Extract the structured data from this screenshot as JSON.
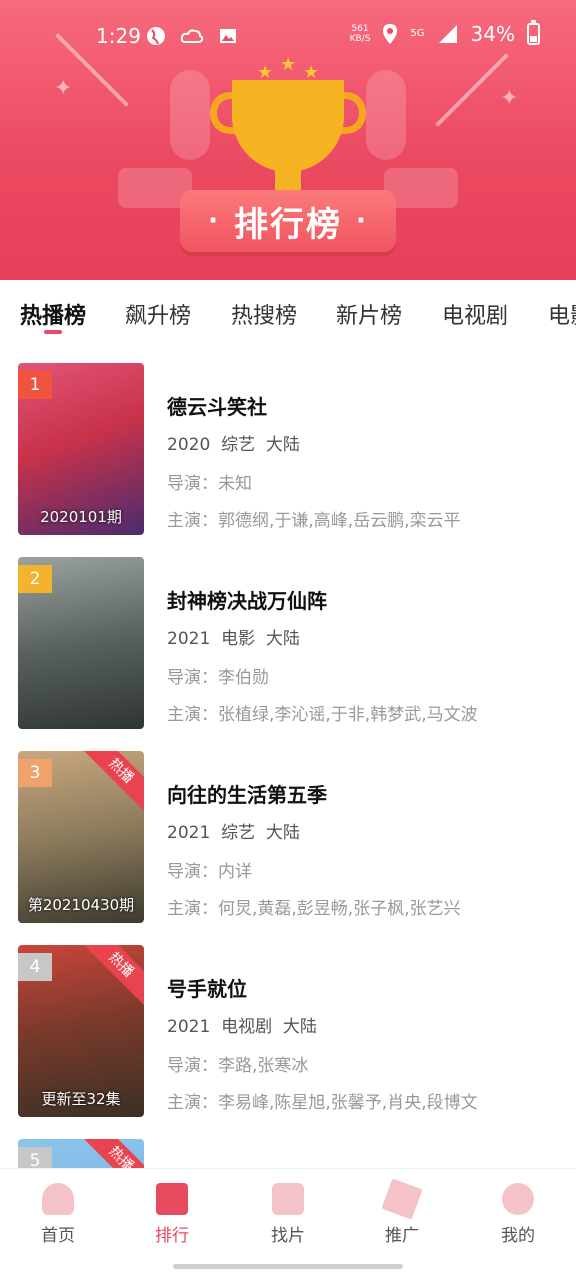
{
  "status_bar": {
    "time": "1:29",
    "netspeed_value": "561",
    "netspeed_unit": "KB/S",
    "network": "5G",
    "battery": "34%"
  },
  "header": {
    "title": "排行榜",
    "dot": "·"
  },
  "tabs": [
    {
      "label": "热播榜",
      "active": true
    },
    {
      "label": "飙升榜",
      "active": false
    },
    {
      "label": "热搜榜",
      "active": false
    },
    {
      "label": "新片榜",
      "active": false
    },
    {
      "label": "电视剧",
      "active": false
    },
    {
      "label": "电影",
      "active": false
    }
  ],
  "list": [
    {
      "rank": "1",
      "title": "德云斗笑社",
      "year": "2020",
      "type": "综艺",
      "region": "大陆",
      "director_label": "导演：",
      "director": "未知",
      "cast_label": "主演：",
      "cast": "郭德纲,于谦,高峰,岳云鹏,栾云平",
      "poster_caption": "2020101期",
      "hot_tag": "",
      "rank_color": "#f0543f",
      "poster_color": "#c8324a"
    },
    {
      "rank": "2",
      "title": "封神榜决战万仙阵",
      "year": "2021",
      "type": "电影",
      "region": "大陆",
      "director_label": "导演：",
      "director": "李伯勋",
      "cast_label": "主演：",
      "cast": "张植绿,李沁谣,于非,韩梦武,马文波",
      "poster_caption": "",
      "hot_tag": "",
      "rank_color": "#f3b32e",
      "poster_color": "#4c5552"
    },
    {
      "rank": "3",
      "title": "向往的生活第五季",
      "year": "2021",
      "type": "综艺",
      "region": "大陆",
      "director_label": "导演：",
      "director": "内详",
      "cast_label": "主演：",
      "cast": "何炅,黄磊,彭昱畅,张子枫,张艺兴",
      "poster_caption": "第20210430期",
      "hot_tag": "热播",
      "rank_color": "#f0a26b",
      "poster_color": "#8a7a5c"
    },
    {
      "rank": "4",
      "title": "号手就位",
      "year": "2021",
      "type": "电视剧",
      "region": "大陆",
      "director_label": "导演：",
      "director": "李路,张寒冰",
      "cast_label": "主演：",
      "cast": "李易峰,陈星旭,张馨予,肖央,段博文",
      "poster_caption": "更新至32集",
      "hot_tag": "热播",
      "rank_color": "#c7c7c7",
      "poster_color": "#7d3a2c"
    },
    {
      "rank": "5",
      "title": "",
      "year": "",
      "type": "",
      "region": "",
      "director_label": "",
      "director": "",
      "cast_label": "",
      "cast": "",
      "poster_caption": "",
      "hot_tag": "热播",
      "rank_color": "#c7c7c7",
      "poster_color": "#6aa8d8"
    }
  ],
  "bottom_nav": [
    {
      "label": "首页",
      "icon": "home-icon",
      "active": false
    },
    {
      "label": "排行",
      "icon": "crown-icon",
      "active": true
    },
    {
      "label": "找片",
      "icon": "play-icon",
      "active": false
    },
    {
      "label": "推广",
      "icon": "share-plane-icon",
      "active": false
    },
    {
      "label": "我的",
      "icon": "user-icon",
      "active": false
    }
  ],
  "colors": {
    "accent": "#ec4a62",
    "trophy": "#f6b423"
  }
}
